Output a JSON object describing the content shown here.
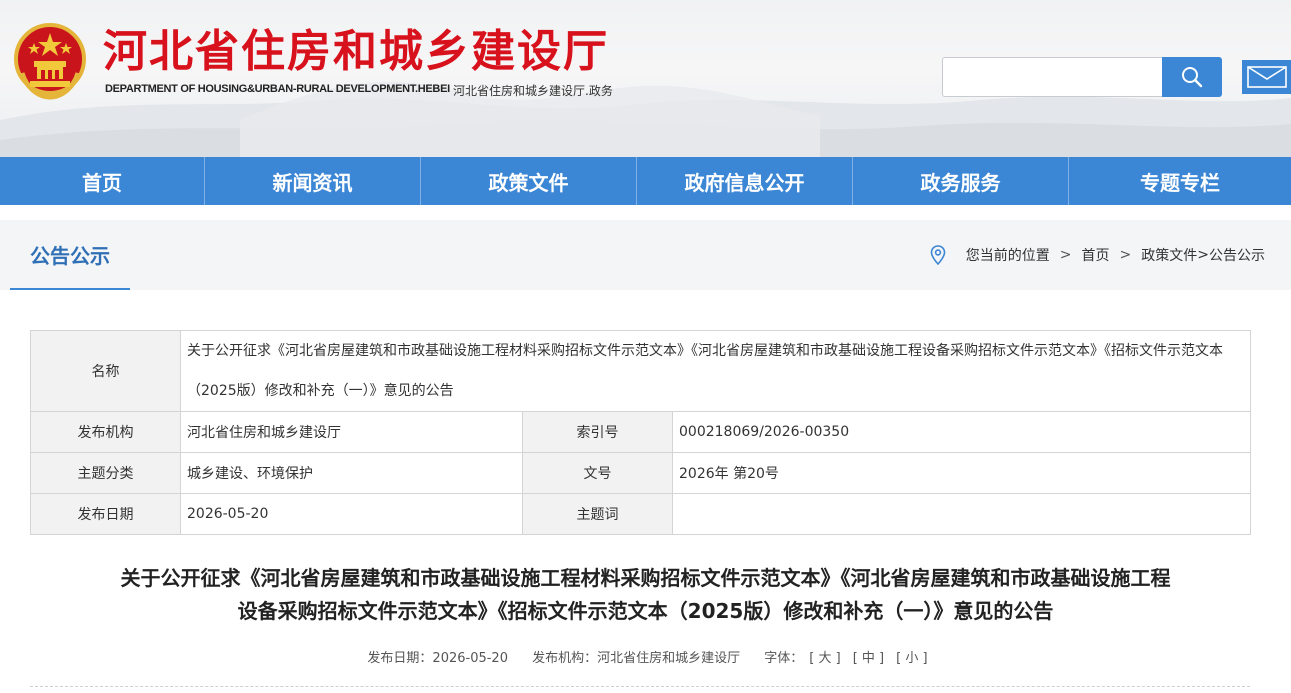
{
  "header": {
    "site_title": "河北省住房和城乡建设厅",
    "site_sub_en": "DEPARTMENT OF HOUSING&URBAN-RURAL DEVELOPMENT.HEBEI",
    "site_sub_cn": "河北省住房和城乡建设厅.政务",
    "search": {
      "value": "",
      "placeholder": ""
    },
    "icons": {
      "emblem": "national-emblem-icon",
      "search": "search-icon",
      "mail": "mail-icon"
    }
  },
  "nav": {
    "items": [
      {
        "label": "首页"
      },
      {
        "label": "新闻资讯"
      },
      {
        "label": "政策文件"
      },
      {
        "label": "政府信息公开"
      },
      {
        "label": "政务服务"
      },
      {
        "label": "专题专栏"
      }
    ]
  },
  "section": {
    "title": "公告公示",
    "breadcrumb": {
      "prefix": "您当前的位置",
      "home": "首页",
      "category": "政策文件",
      "current": "公告公示",
      "separator": ">"
    }
  },
  "info": {
    "name_label": "名称",
    "name_value": "关于公开征求《河北省房屋建筑和市政基础设施工程材料采购招标文件示范文本》《河北省房屋建筑和市政基础设施工程设备采购招标文件示范文本》《招标文件示范文本（2025版）修改和补充（一）》意见的公告",
    "publisher_label": "发布机构",
    "publisher_value": "河北省住房和城乡建设厅",
    "index_label": "索引号",
    "index_value": "000218069/2026-00350",
    "topic_label": "主题分类",
    "topic_value": "城乡建设、环境保护",
    "doc_no_label": "文号",
    "doc_no_value": "2026年 第20号",
    "date_label": "发布日期",
    "date_value": "2026-05-20",
    "keyword_label": "主题词",
    "keyword_value": ""
  },
  "article": {
    "title_line1": "关于公开征求《河北省房屋建筑和市政基础设施工程材料采购招标文件示范文本》《河北省房屋建筑和市政基础设施工程",
    "title_line2": "设备采购招标文件示范文本》《招标文件示范文本（2025版）修改和补充（一）》意见的公告",
    "meta": {
      "date": "发布日期：2026-05-20",
      "publisher": "发布机构：河北省住房和城乡建设厅",
      "font_label": "字体：",
      "font_large": "[ 大 ]",
      "font_medium": "[ 中 ]",
      "font_small": "[ 小 ]"
    }
  },
  "colors": {
    "brand_red": "#d8121c",
    "nav_blue": "#3b86d5",
    "section_title_blue": "#2f6fb6",
    "section_bg": "#f3f5f7"
  }
}
